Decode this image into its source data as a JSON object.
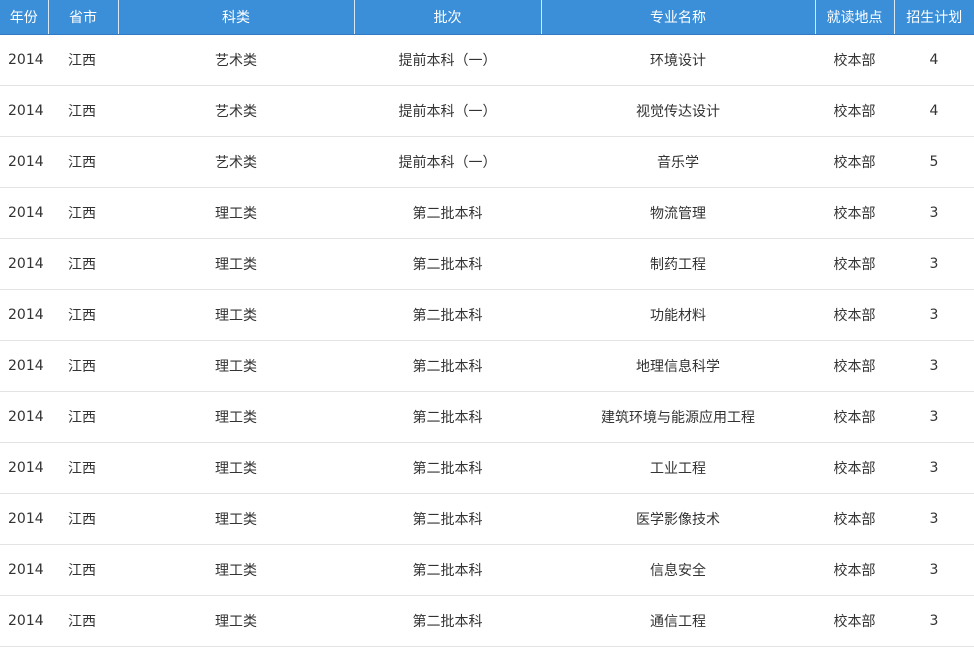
{
  "table": {
    "headers": [
      "年份",
      "省市",
      "科类",
      "批次",
      "专业名称",
      "就读地点",
      "招生计划"
    ],
    "rows": [
      [
        "2014",
        "江西",
        "艺术类",
        "提前本科（一）",
        "环境设计",
        "校本部",
        "4"
      ],
      [
        "2014",
        "江西",
        "艺术类",
        "提前本科（一）",
        "视觉传达设计",
        "校本部",
        "4"
      ],
      [
        "2014",
        "江西",
        "艺术类",
        "提前本科（一）",
        "音乐学",
        "校本部",
        "5"
      ],
      [
        "2014",
        "江西",
        "理工类",
        "第二批本科",
        "物流管理",
        "校本部",
        "3"
      ],
      [
        "2014",
        "江西",
        "理工类",
        "第二批本科",
        "制药工程",
        "校本部",
        "3"
      ],
      [
        "2014",
        "江西",
        "理工类",
        "第二批本科",
        "功能材料",
        "校本部",
        "3"
      ],
      [
        "2014",
        "江西",
        "理工类",
        "第二批本科",
        "地理信息科学",
        "校本部",
        "3"
      ],
      [
        "2014",
        "江西",
        "理工类",
        "第二批本科",
        "建筑环境与能源应用工程",
        "校本部",
        "3"
      ],
      [
        "2014",
        "江西",
        "理工类",
        "第二批本科",
        "工业工程",
        "校本部",
        "3"
      ],
      [
        "2014",
        "江西",
        "理工类",
        "第二批本科",
        "医学影像技术",
        "校本部",
        "3"
      ],
      [
        "2014",
        "江西",
        "理工类",
        "第二批本科",
        "信息安全",
        "校本部",
        "3"
      ],
      [
        "2014",
        "江西",
        "理工类",
        "第二批本科",
        "通信工程",
        "校本部",
        "3"
      ]
    ]
  },
  "colors": {
    "header_bg": "#3b8fd8",
    "header_text": "#ffffff",
    "body_text": "#333333",
    "row_divider": "#e3e3e3"
  }
}
